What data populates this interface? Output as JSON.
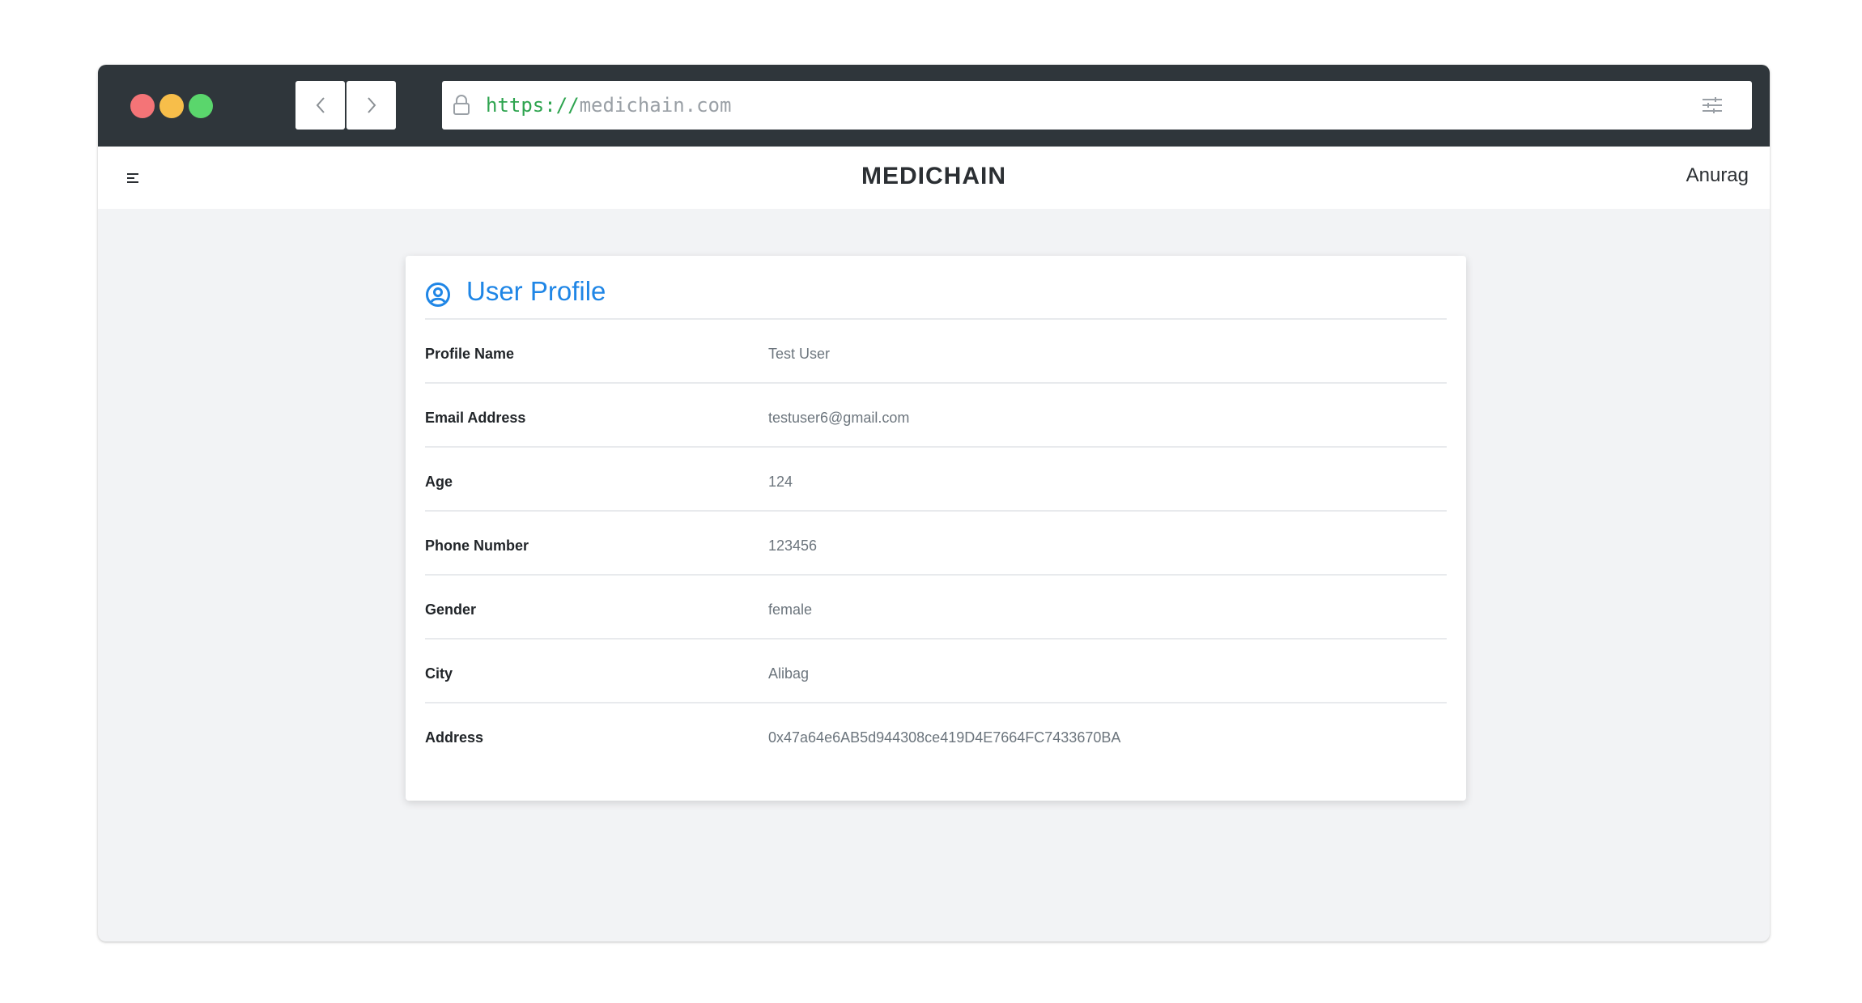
{
  "browser": {
    "url_scheme": "https://",
    "url_host": "medichain.com"
  },
  "app": {
    "brand": "MEDICHAIN",
    "user": "Anurag"
  },
  "profile": {
    "title": "User Profile",
    "rows": [
      {
        "label": "Profile Name",
        "value": "Test User"
      },
      {
        "label": "Email Address",
        "value": "testuser6@gmail.com"
      },
      {
        "label": "Age",
        "value": "124"
      },
      {
        "label": "Phone Number",
        "value": "123456"
      },
      {
        "label": "Gender",
        "value": "female"
      },
      {
        "label": "City",
        "value": "Alibag"
      },
      {
        "label": "Address",
        "value": "0x47a64e6AB5d944308ce419D4E7664FC7433670BA"
      }
    ]
  },
  "colors": {
    "accent": "#1f86e6",
    "chrome": "#2f363b",
    "page_bg": "#f2f3f5"
  }
}
